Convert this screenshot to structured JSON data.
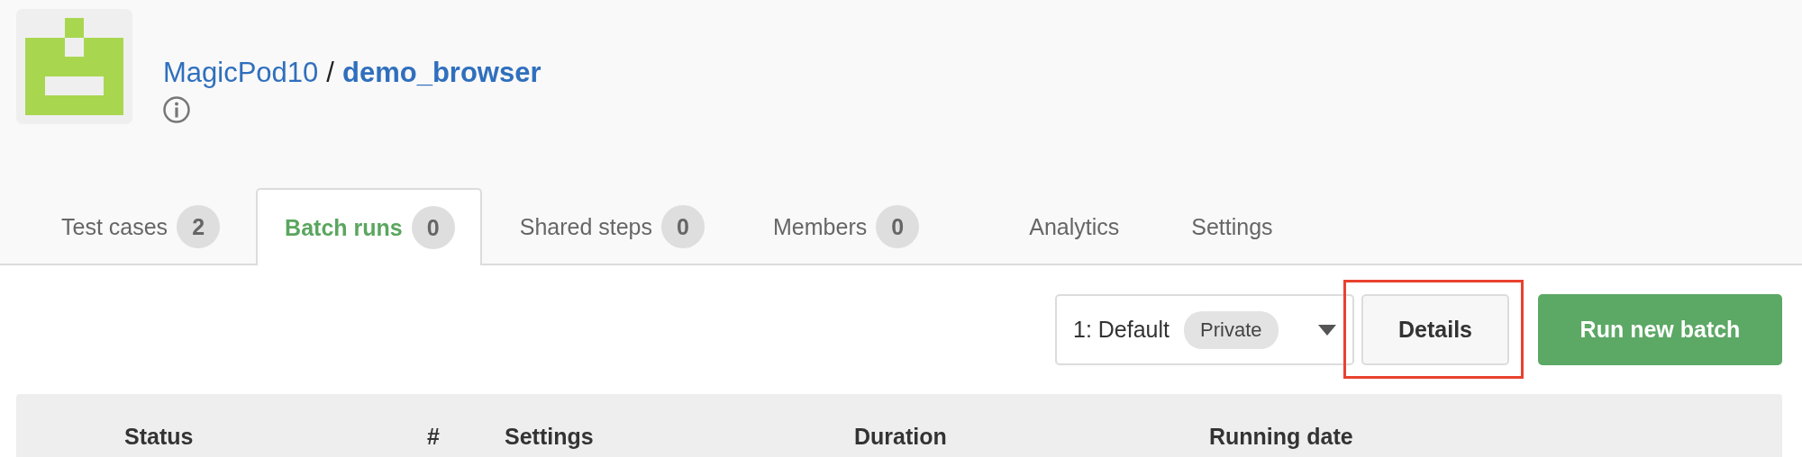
{
  "project": {
    "owner": "MagicPod10",
    "separator": "/",
    "name": "demo_browser"
  },
  "tabs": [
    {
      "label": "Test cases",
      "count": "2",
      "selected": false
    },
    {
      "label": "Batch runs",
      "count": "0",
      "selected": true
    },
    {
      "label": "Shared steps",
      "count": "0",
      "selected": false
    },
    {
      "label": "Members",
      "count": "0",
      "selected": false
    },
    {
      "label": "Analytics",
      "selected": false
    },
    {
      "label": "Settings",
      "selected": false
    }
  ],
  "toolbar": {
    "setting_select": {
      "value": "1: Default",
      "badge": "Private"
    },
    "details_button": {
      "label": "Details",
      "highlighted": true
    },
    "run_button": {
      "label": "Run new batch"
    }
  },
  "table": {
    "columns": [
      "Status",
      "#",
      "Settings",
      "Duration",
      "Running date"
    ]
  }
}
